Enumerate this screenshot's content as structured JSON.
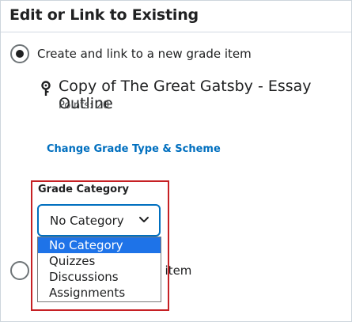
{
  "header": {
    "title": "Edit or Link to Existing"
  },
  "options": {
    "create_new_label": "Create and link to a new grade item",
    "link_existing_label_visible": "de item"
  },
  "grade_item": {
    "icon": "grade-pin-icon",
    "name": "Copy of The Great Gatsby - Essay Outline",
    "points": "Points: 20"
  },
  "change_link": {
    "label": "Change Grade Type & Scheme"
  },
  "category": {
    "label": "Grade Category",
    "selected": "No Category",
    "options": [
      "No Category",
      "Quizzes",
      "Discussions",
      "Assignments"
    ]
  },
  "colors": {
    "link": "#006fbf",
    "highlight_border": "#c62024",
    "option_selected_bg": "#1e73e8"
  }
}
